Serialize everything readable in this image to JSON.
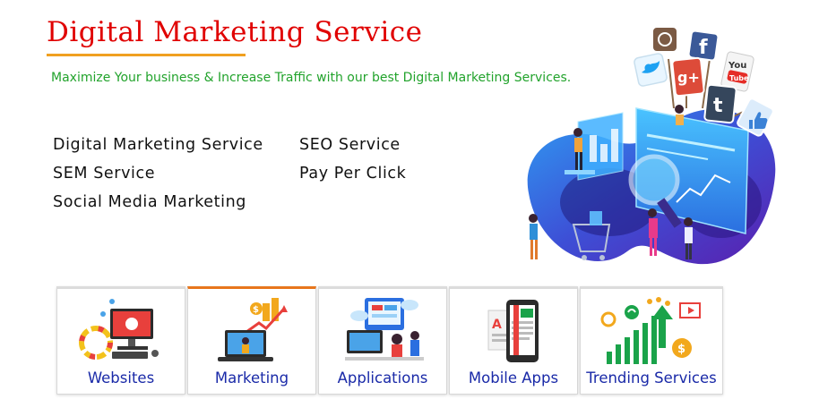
{
  "header": {
    "title": "Digital Marketing Service",
    "tagline": "Maximize Your business & Increase Traffic with our best  Digital Marketing Services."
  },
  "services": [
    "Digital Marketing Service",
    "SEO Service",
    "SEM Service",
    "Pay Per Click",
    "Social Media Marketing"
  ],
  "hero": {
    "icons": [
      "instagram-icon",
      "facebook-icon",
      "twitter-icon",
      "google-plus-icon",
      "youtube-icon",
      "tumblr-icon",
      "like-icon"
    ],
    "youtube_badge": "You",
    "youtube_sub": "Tube"
  },
  "tiles": [
    {
      "label": "Websites",
      "icon": "website-icon"
    },
    {
      "label": "Marketing",
      "icon": "marketing-icon"
    },
    {
      "label": "Applications",
      "icon": "applications-icon"
    },
    {
      "label": "Mobile Apps",
      "icon": "mobile-apps-icon"
    },
    {
      "label": "Trending Services",
      "icon": "trending-services-icon"
    }
  ],
  "colors": {
    "title": "#e00000",
    "underline": "#f0a020",
    "tagline": "#22a32c",
    "tile_label": "#1a2aa8",
    "active_tile_accent": "#e8761c",
    "hero_purple": "#4b2bb8",
    "hero_blue": "#2e8cf0"
  }
}
